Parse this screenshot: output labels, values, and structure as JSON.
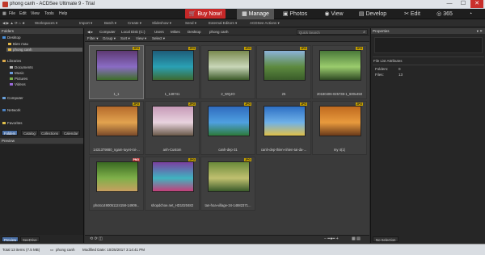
{
  "window": {
    "title": "phong canh - ACDSee Ultimate 9 - Trial",
    "minimize": "—",
    "maximize": "☐",
    "close": "✕"
  },
  "menu": [
    "File",
    "Edit",
    "View",
    "Tools",
    "Help"
  ],
  "modes": {
    "buy_now": "Buy Now!",
    "manage": "Manage",
    "photos": "Photos",
    "view": "View",
    "develop": "Develop",
    "edit": "Edit",
    "online": "365"
  },
  "toolbar": {
    "items": [
      "Workspaces ▾",
      "Import ▾",
      "Batch ▾",
      "Create ▾",
      "Slideshow ▾",
      "Send ▾",
      "External Editors ▾",
      "ACDSee Actions ▾"
    ]
  },
  "folders": {
    "header": "Folders",
    "desktop": "Desktop",
    "items": [
      "Bien mau",
      "phong canh"
    ],
    "libraries": "Libraries",
    "lib_items": [
      "Documents",
      "Music",
      "Pictures",
      "Videos"
    ],
    "computer": "Computer",
    "network": "Network",
    "favorites": "Favorites",
    "tabs": [
      "Folders",
      "Catalog",
      "Collections",
      "Calendar"
    ]
  },
  "preview": {
    "header": "Preview",
    "tabs": [
      "Preview",
      "SeeDrive"
    ]
  },
  "address": {
    "crumbs": [
      "Computer",
      "Local Disk (C:)",
      "Users",
      "Mikes",
      "Desktop",
      "phong canh"
    ],
    "search_placeholder": "Quick Search"
  },
  "filterbar": [
    "Filter ▾",
    "Group ▾",
    "Sort ▾",
    "View ▾",
    "Select ▾"
  ],
  "thumbnails": [
    {
      "name": "1_1",
      "badge": "JPG",
      "colors": [
        "#5e3a73",
        "#8a6cc4",
        "#3f6e2a"
      ]
    },
    {
      "name": "1_148741",
      "badge": "JPG",
      "colors": [
        "#1e5d7a",
        "#2aa0b4",
        "#3d6a31"
      ]
    },
    {
      "name": "2_WQJO",
      "badge": "JPG",
      "colors": [
        "#7a8a4f",
        "#c8d6b8",
        "#3d5a2a"
      ]
    },
    {
      "name": "25",
      "badge": "JPG",
      "colors": [
        "#8cb3d9",
        "#5d8a3f",
        "#3a5c2a"
      ]
    },
    {
      "name": "20180406-025738-1_600x450",
      "badge": "JPG",
      "colors": [
        "#4a7a3a",
        "#9acb6d",
        "#2f4a24"
      ]
    },
    {
      "name": "1431379880_ngam-tuyet-roi-...",
      "badge": "JPG",
      "colors": [
        "#b56a2b",
        "#e2a34f",
        "#7a4a2a"
      ]
    },
    {
      "name": "anh-Custom",
      "badge": "JPG",
      "colors": [
        "#c79ab8",
        "#e8d3de",
        "#6a5a4a"
      ]
    },
    {
      "name": "canh-dep-31",
      "badge": "JPG",
      "colors": [
        "#2f6bbf",
        "#4fa0e0",
        "#2d7a3a"
      ]
    },
    {
      "name": "canh-dep-thien-nhien-tai-da-...",
      "badge": "JPG",
      "colors": [
        "#2d6fc4",
        "#6fb1e8",
        "#e0c04a"
      ]
    },
    {
      "name": "my 4(1)",
      "badge": "JPG",
      "colors": [
        "#c06a1f",
        "#e89a3d",
        "#6a3a1a"
      ]
    },
    {
      "name": "photo1490051124158-14909...",
      "badge": "PNG",
      "colors": [
        "#3a6a22",
        "#7fb04a",
        "#c8a060"
      ]
    },
    {
      "name": "shopdchoe.net_HD1020482",
      "badge": "JPG",
      "colors": [
        "#7a3fa0",
        "#3fb4c0",
        "#c43f7a"
      ]
    },
    {
      "name": "tan-hoa-village-34-14882371...",
      "badge": "JPG",
      "colors": [
        "#6a8a3a",
        "#c0c070",
        "#3a5a2a"
      ]
    }
  ],
  "properties": {
    "header": "Properties",
    "section": "File List Attributes",
    "folders_label": "Folders:",
    "folders_value": "0",
    "files_label": "Files:",
    "files_value": "13",
    "tab": "No Selection"
  },
  "status": {
    "total": "Total 13 items  (7.5 MB)",
    "folder": "phong canh",
    "modified": "Modified Date: 10/25/2017 3:14:41 PM"
  },
  "colors": {
    "accent_red": "#c62828",
    "panel": "#262626",
    "center": "#3a3a3a"
  }
}
